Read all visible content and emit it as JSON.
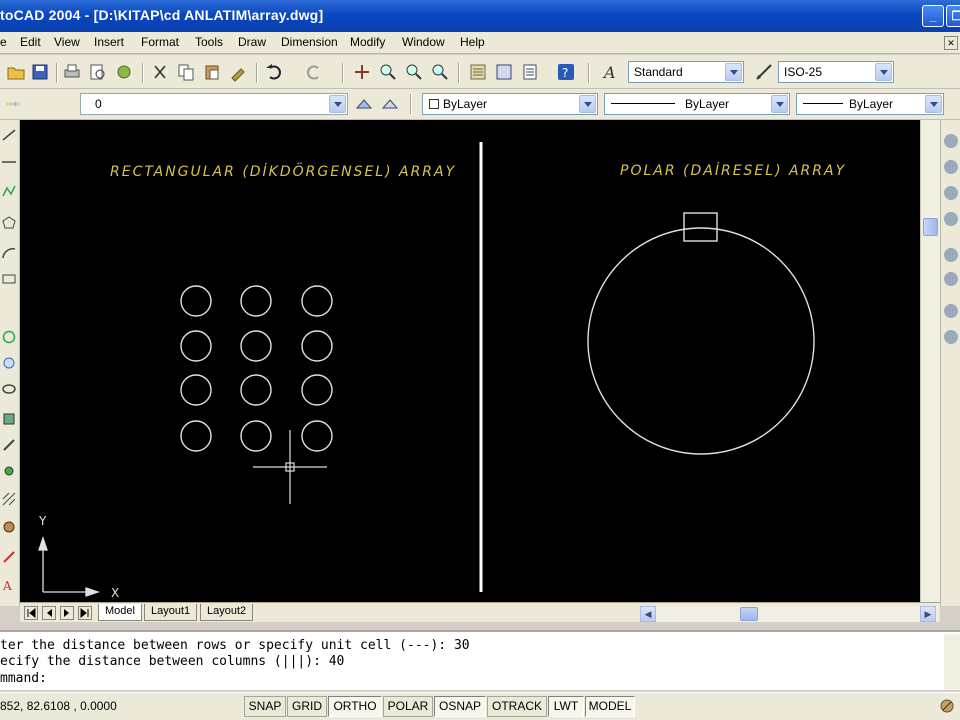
{
  "app": {
    "title": "toCAD 2004 - [D:\\KITAP\\cd ANLATIM\\array.dwg]"
  },
  "window_buttons": {
    "minimize": "_",
    "restore": "❐",
    "close": "✕"
  },
  "menu": [
    "e",
    "Edit",
    "View",
    "Insert",
    "Format",
    "Tools",
    "Draw",
    "Dimension",
    "Modify",
    "Window",
    "Help"
  ],
  "toolbar": {
    "text_style": "Standard",
    "dim_style": "ISO-25",
    "layer": "0",
    "color": "ByLayer",
    "linetype": "ByLayer",
    "lineweight": "ByLayer"
  },
  "canvas": {
    "left_label": "RECTANGULAR (DİKDÖRGENSEL) ARRAY",
    "right_label": "POLAR (DAİRESEL) ARRAY",
    "ucs_x": "X",
    "ucs_y": "Y",
    "colors": {
      "background": "#000000",
      "geometry": "#e0e0e0",
      "text": "#d9c24a"
    }
  },
  "tabs": [
    "Model",
    "Layout1",
    "Layout2"
  ],
  "command": {
    "line1": "ter the distance between rows or specify unit cell (---): 30",
    "line2": "ecify the distance between columns (|||): 40",
    "line3": "mmand:"
  },
  "status": {
    "coords": "852, 82.6108 , 0.0000",
    "buttons": [
      {
        "label": "SNAP",
        "on": false
      },
      {
        "label": "GRID",
        "on": false
      },
      {
        "label": "ORTHO",
        "on": true
      },
      {
        "label": "POLAR",
        "on": false
      },
      {
        "label": "OSNAP",
        "on": true
      },
      {
        "label": "OTRACK",
        "on": false
      },
      {
        "label": "LWT",
        "on": true
      },
      {
        "label": "MODEL",
        "on": true
      }
    ]
  }
}
